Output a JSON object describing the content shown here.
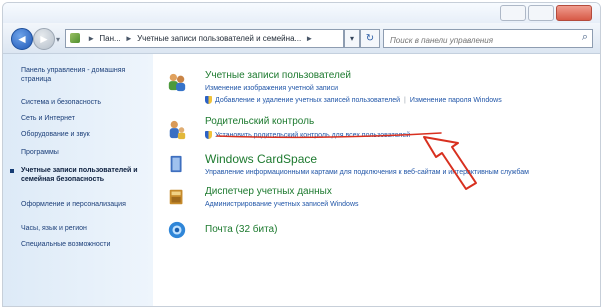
{
  "titlebar": {
    "buttons": [
      "minimize",
      "maximize",
      "close"
    ]
  },
  "navbar": {
    "back": "◄",
    "forward": "►",
    "address_segments": [
      "Пан...",
      "Учетные записи пользователей и семейна..."
    ],
    "search_placeholder": "Поиск в панели управления"
  },
  "sidebar": {
    "items": [
      {
        "label": "Панель управления - домашняя страница",
        "current": false
      },
      {
        "label": "Система и безопасность",
        "current": false
      },
      {
        "label": "Сеть и Интернет",
        "current": false
      },
      {
        "label": "Оборудование и звук",
        "current": false
      },
      {
        "label": "Программы",
        "current": false
      },
      {
        "label": "Учетные записи пользователей и семейная безопасность",
        "current": true
      },
      {
        "label": "Оформление и персонализация",
        "current": false
      },
      {
        "label": "Часы, язык и регион",
        "current": false
      },
      {
        "label": "Специальные возможности",
        "current": false
      }
    ]
  },
  "categories": [
    {
      "title": "Учетные записи пользователей",
      "icon": "users-icon",
      "links": [
        "Изменение изображения учетной записи",
        "Добавление и удаление учетных записей пользователей",
        "Изменение пароля Windows"
      ]
    },
    {
      "title": "Родительский контроль",
      "icon": "parental-control-icon",
      "links": [
        "Установить родительский контроль для всех пользователей"
      ]
    },
    {
      "title": "Windows CardSpace",
      "icon": "cardspace-icon",
      "links": [
        "Управление информационными картами для подключения к веб-сайтам и интерактивным службам"
      ]
    },
    {
      "title": "Диспетчер учетных данных",
      "icon": "credential-manager-icon",
      "links": [
        "Администрирование учетных записей Windows"
      ]
    },
    {
      "title": "Почта (32 бита)",
      "icon": "mail-icon",
      "links": []
    }
  ],
  "annotation": {
    "color": "#d8301f"
  },
  "colors": {
    "link": "#2156a8",
    "category_title": "#1d7a2f",
    "sidebar_bg": "#e4eef9"
  }
}
